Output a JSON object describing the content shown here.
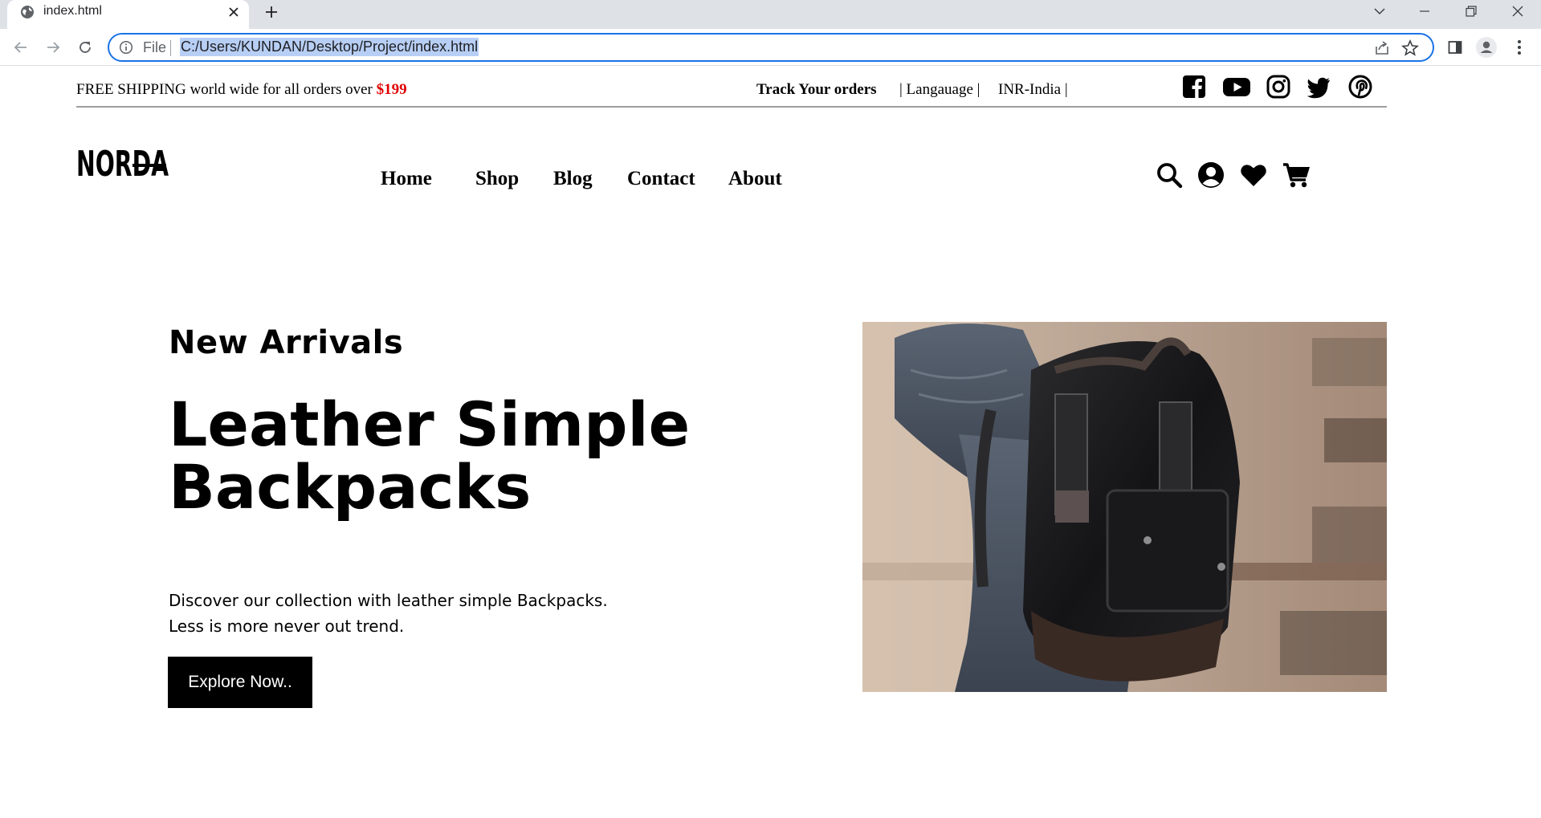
{
  "browser": {
    "tab_title": "index.html",
    "omnibox": {
      "scheme_label": "File",
      "url": "C:/Users/KUNDAN/Desktop/Project/index.html"
    }
  },
  "topbar": {
    "promo_text": "FREE SHIPPING world wide for all orders over",
    "promo_price": "$199",
    "track_orders": "Track Your orders",
    "language": "| Langauage |",
    "currency": "INR-India |",
    "social_icons": [
      "facebook-icon",
      "youtube-icon",
      "instagram-icon",
      "twitter-icon",
      "pinterest-icon"
    ]
  },
  "header": {
    "logo_text": "NORDA",
    "nav": [
      {
        "label": "Home"
      },
      {
        "label": "Shop"
      },
      {
        "label": "Blog"
      },
      {
        "label": "Contact"
      },
      {
        "label": "About"
      }
    ],
    "icons": [
      "search-icon",
      "account-icon",
      "heart-icon",
      "cart-icon"
    ]
  },
  "hero": {
    "eyebrow": "New Arrivals",
    "headline_line1": "Leather Simple",
    "headline_line2": "Backpacks",
    "description_line1": "Discover our collection with leather simple Backpacks.",
    "description_line2": "Less is more never out trend.",
    "cta_label": "Explore Now.."
  },
  "colors": {
    "accent_price": "#e00000",
    "omnibox_focus": "#1a73e8",
    "url_selection": "#b8cff5",
    "button_bg": "#000000"
  }
}
